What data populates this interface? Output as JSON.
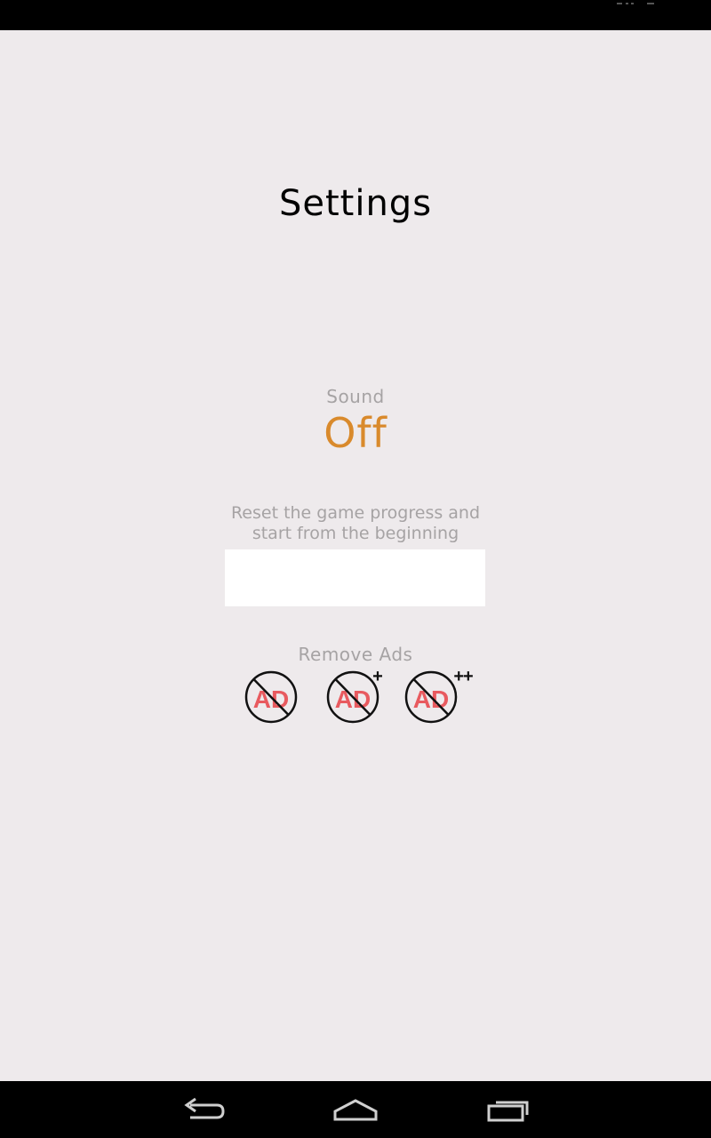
{
  "screen": {
    "title": "Settings"
  },
  "sound": {
    "label": "Sound",
    "value": "Off"
  },
  "reset": {
    "label": "Reset the game progress and start from the beginning",
    "button_label": ""
  },
  "remove_ads": {
    "label": "Remove Ads",
    "options": [
      {
        "icon": "no-ads-icon",
        "badge": ""
      },
      {
        "icon": "no-ads-plus-icon",
        "badge": "+"
      },
      {
        "icon": "no-ads-plus-plus-icon",
        "badge": "++"
      }
    ],
    "icon_text": "AD"
  },
  "colors": {
    "background": "#eeeaec",
    "accent": "#d98a2c",
    "muted_text": "#a6a3a4",
    "ad_red": "#e85a5f"
  },
  "nav": {
    "icons": [
      "back-icon",
      "home-icon",
      "recent-apps-icon"
    ]
  }
}
